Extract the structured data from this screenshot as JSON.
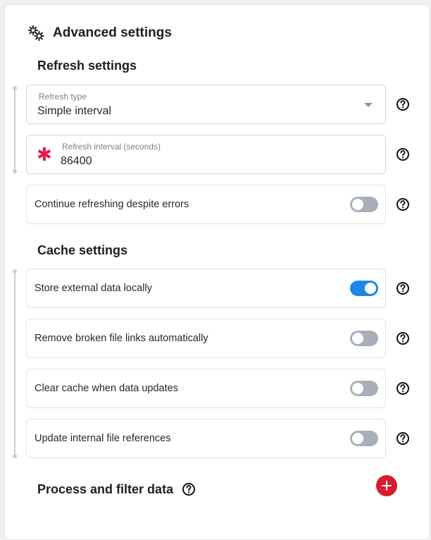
{
  "panel": {
    "title": "Advanced settings",
    "icon": "gears-icon"
  },
  "refresh": {
    "section_title": "Refresh settings",
    "type_label": "Refresh type",
    "type_value": "Simple interval",
    "interval_label": "Refresh interval (seconds)",
    "interval_value": "86400",
    "continue_label": "Continue refreshing despite errors",
    "continue_on": false
  },
  "cache": {
    "section_title": "Cache settings",
    "items": [
      {
        "label": "Store external data locally",
        "on": true
      },
      {
        "label": "Remove broken file links automatically",
        "on": false
      },
      {
        "label": "Clear cache when data updates",
        "on": false
      },
      {
        "label": "Update internal file references",
        "on": false
      }
    ]
  },
  "process": {
    "title": "Process and filter data"
  },
  "colors": {
    "toggle_on": "#1f86e6",
    "toggle_off": "#a9afb8",
    "required": "#e11d48",
    "add_button": "#d91c2f"
  }
}
